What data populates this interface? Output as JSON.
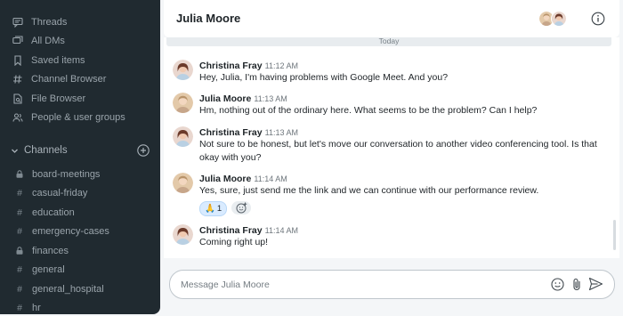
{
  "sidebar": {
    "nav": [
      {
        "label": "Threads",
        "icon": "threads-icon"
      },
      {
        "label": "All DMs",
        "icon": "dms-icon"
      },
      {
        "label": "Saved items",
        "icon": "bookmark-icon"
      },
      {
        "label": "Channel Browser",
        "icon": "channel-browser-icon"
      },
      {
        "label": "File Browser",
        "icon": "file-browser-icon"
      },
      {
        "label": "People & user groups",
        "icon": "people-icon"
      }
    ],
    "channels_label": "Channels",
    "channels": [
      {
        "name": "board-meetings",
        "private": true
      },
      {
        "name": "casual-friday",
        "private": false
      },
      {
        "name": "education",
        "private": false
      },
      {
        "name": "emergency-cases",
        "private": false
      },
      {
        "name": "finances",
        "private": true
      },
      {
        "name": "general",
        "private": false
      },
      {
        "name": "general_hospital",
        "private": false
      },
      {
        "name": "hr",
        "private": false
      }
    ]
  },
  "header": {
    "title": "Julia Moore"
  },
  "conversation": {
    "date_divider": "Today",
    "messages": [
      {
        "author": "Christina Fray",
        "time": "11:12 AM",
        "text": "Hey, Julia, I'm having problems with Google Meet. And you?"
      },
      {
        "author": "Julia Moore",
        "time": "11:13 AM",
        "text": "Hm, nothing out of the ordinary here. What seems to be the problem? Can I help?"
      },
      {
        "author": "Christina Fray",
        "time": "11:13 AM",
        "text": "Not sure to be honest, but let's move our conversation to another video conferencing tool. Is that okay with you?"
      },
      {
        "author": "Julia Moore",
        "time": "11:14 AM",
        "text": "Yes, sure, just send me the link and we can continue with our performance review.",
        "reaction": {
          "emoji": "🙏",
          "count": "1"
        }
      },
      {
        "author": "Christina Fray",
        "time": "11:14 AM",
        "text": "Coming right up!"
      }
    ]
  },
  "composer": {
    "placeholder": "Message Julia Moore"
  },
  "colors": {
    "sidebar_bg": "#202a30",
    "accent": "#d9ebff"
  }
}
